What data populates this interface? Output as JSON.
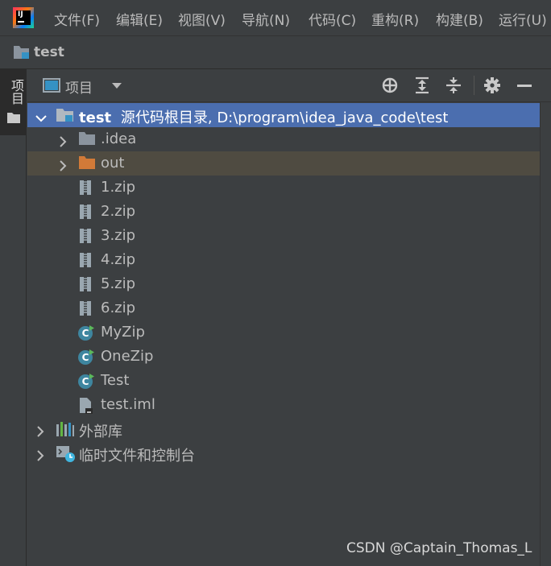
{
  "menubar": {
    "items": [
      {
        "label": "文件(F)"
      },
      {
        "label": "编辑(E)"
      },
      {
        "label": "视图(V)"
      },
      {
        "label": "导航(N)"
      },
      {
        "label": "代码(C)"
      },
      {
        "label": "重构(R)"
      },
      {
        "label": "构建(B)"
      },
      {
        "label": "运行(U)"
      }
    ],
    "logo_text": "IJ"
  },
  "navbar": {
    "project_name": "test"
  },
  "left_stripe": {
    "tab_label": "项目"
  },
  "tool_window": {
    "title": "项目",
    "icons": [
      "locate-icon",
      "expand-all-icon",
      "collapse-all-icon",
      "gear-icon",
      "hide-icon"
    ]
  },
  "tree": {
    "root": {
      "name": "test",
      "detail": "源代码根目录, D:\\program\\idea_java_code\\test"
    },
    "items": [
      {
        "name": ".idea",
        "type": "folder"
      },
      {
        "name": "out",
        "type": "folder-excluded"
      },
      {
        "name": "1.zip",
        "type": "archive"
      },
      {
        "name": "2.zip",
        "type": "archive"
      },
      {
        "name": "3.zip",
        "type": "archive"
      },
      {
        "name": "4.zip",
        "type": "archive"
      },
      {
        "name": "5.zip",
        "type": "archive"
      },
      {
        "name": "6.zip",
        "type": "archive"
      },
      {
        "name": "MyZip",
        "type": "java-class"
      },
      {
        "name": "OneZip",
        "type": "java-class"
      },
      {
        "name": "Test",
        "type": "java-class"
      },
      {
        "name": "test.iml",
        "type": "module-file"
      }
    ],
    "external_libraries": "外部库",
    "scratches": "临时文件和控制台"
  },
  "colors": {
    "selection": "#4b6eaf",
    "excluded_row": "#4f4b41",
    "folder": "#8b949e",
    "excluded_folder": "#d17a38",
    "class_icon": "#3e86a0"
  },
  "watermark": "CSDN @Captain_Thomas_L"
}
